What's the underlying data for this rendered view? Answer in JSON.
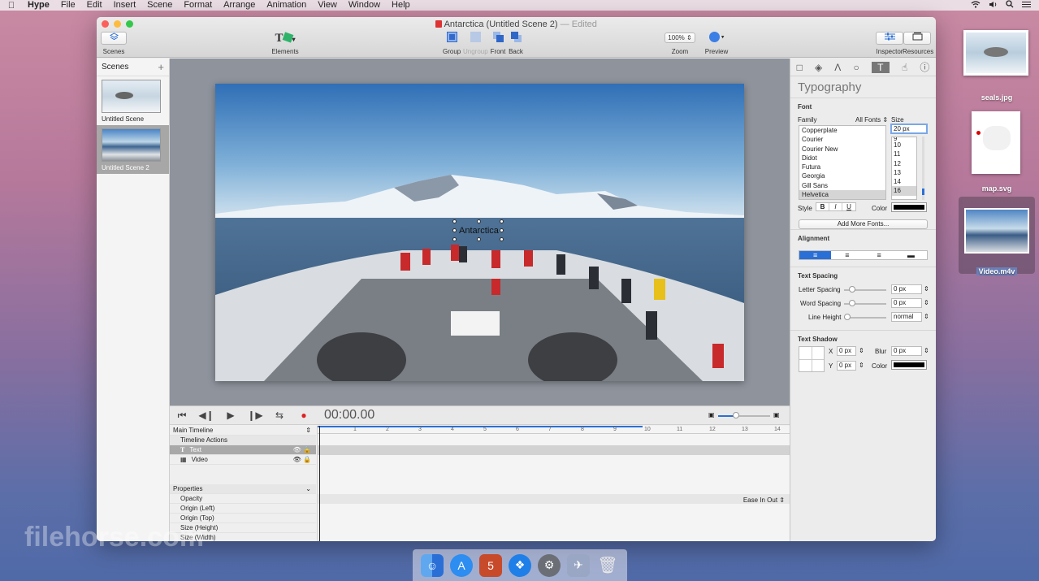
{
  "menubar": {
    "items": [
      "Hype",
      "File",
      "Edit",
      "Insert",
      "Scene",
      "Format",
      "Arrange",
      "Animation",
      "View",
      "Window",
      "Help"
    ]
  },
  "window": {
    "title": "Antarctica (Untitled Scene 2)",
    "edited": "— Edited"
  },
  "toolbar": {
    "scenes": "Scenes",
    "elements": "Elements",
    "group": "Group",
    "ungroup": "Ungroup",
    "front": "Front",
    "back": "Back",
    "zoom_value": "100%",
    "zoom": "Zoom",
    "preview": "Preview",
    "inspector": "Inspector",
    "resources": "Resources"
  },
  "scenes_panel": {
    "header": "Scenes",
    "add": "+",
    "items": [
      {
        "label": "Untitled Scene"
      },
      {
        "label": "Untitled Scene 2"
      }
    ]
  },
  "stage": {
    "text": "Antarctica"
  },
  "timeline": {
    "time": "00:00.00",
    "main_timeline": "Main Timeline",
    "rows": [
      "Timeline Actions",
      "Text",
      "Video"
    ],
    "properties_header": "Properties",
    "ease": "Ease In Out",
    "properties": [
      "Opacity",
      "Origin (Left)",
      "Origin (Top)",
      "Size (Height)",
      "Size (Width)"
    ],
    "ruler": [
      "1",
      "2",
      "3",
      "4",
      "5",
      "6",
      "7",
      "8",
      "9",
      "10",
      "11",
      "12",
      "13",
      "14"
    ]
  },
  "inspector": {
    "title": "Typography",
    "font_section": "Font",
    "family_label": "Family",
    "all_fonts": "All Fonts",
    "size_label": "Size",
    "size_value": "20 px",
    "fonts": [
      "Copperplate",
      "Courier",
      "Courier New",
      "Didot",
      "Futura",
      "Georgia",
      "Gill Sans",
      "Helvetica"
    ],
    "sizes": [
      "9",
      "10",
      "11",
      "12",
      "13",
      "14",
      "16"
    ],
    "style_label": "Style",
    "bold": "B",
    "italic": "I",
    "underline": "U",
    "color_label": "Color",
    "add_fonts": "Add More Fonts...",
    "alignment_section": "Alignment",
    "spacing_section": "Text Spacing",
    "letter_spacing": "Letter Spacing",
    "letter_spacing_value": "0 px",
    "word_spacing": "Word Spacing",
    "word_spacing_value": "0 px",
    "line_height": "Line Height",
    "line_height_value": "normal",
    "shadow_section": "Text Shadow",
    "x_label": "X",
    "x_value": "0 px",
    "y_label": "Y",
    "y_value": "0 px",
    "blur_label": "Blur",
    "blur_value": "0 px",
    "shadow_color_label": "Color"
  },
  "desktop": {
    "files": [
      {
        "name": "seals.jpg"
      },
      {
        "name": "map.svg"
      },
      {
        "name": "Video.m4v"
      }
    ]
  },
  "watermark": "filehorse.com"
}
